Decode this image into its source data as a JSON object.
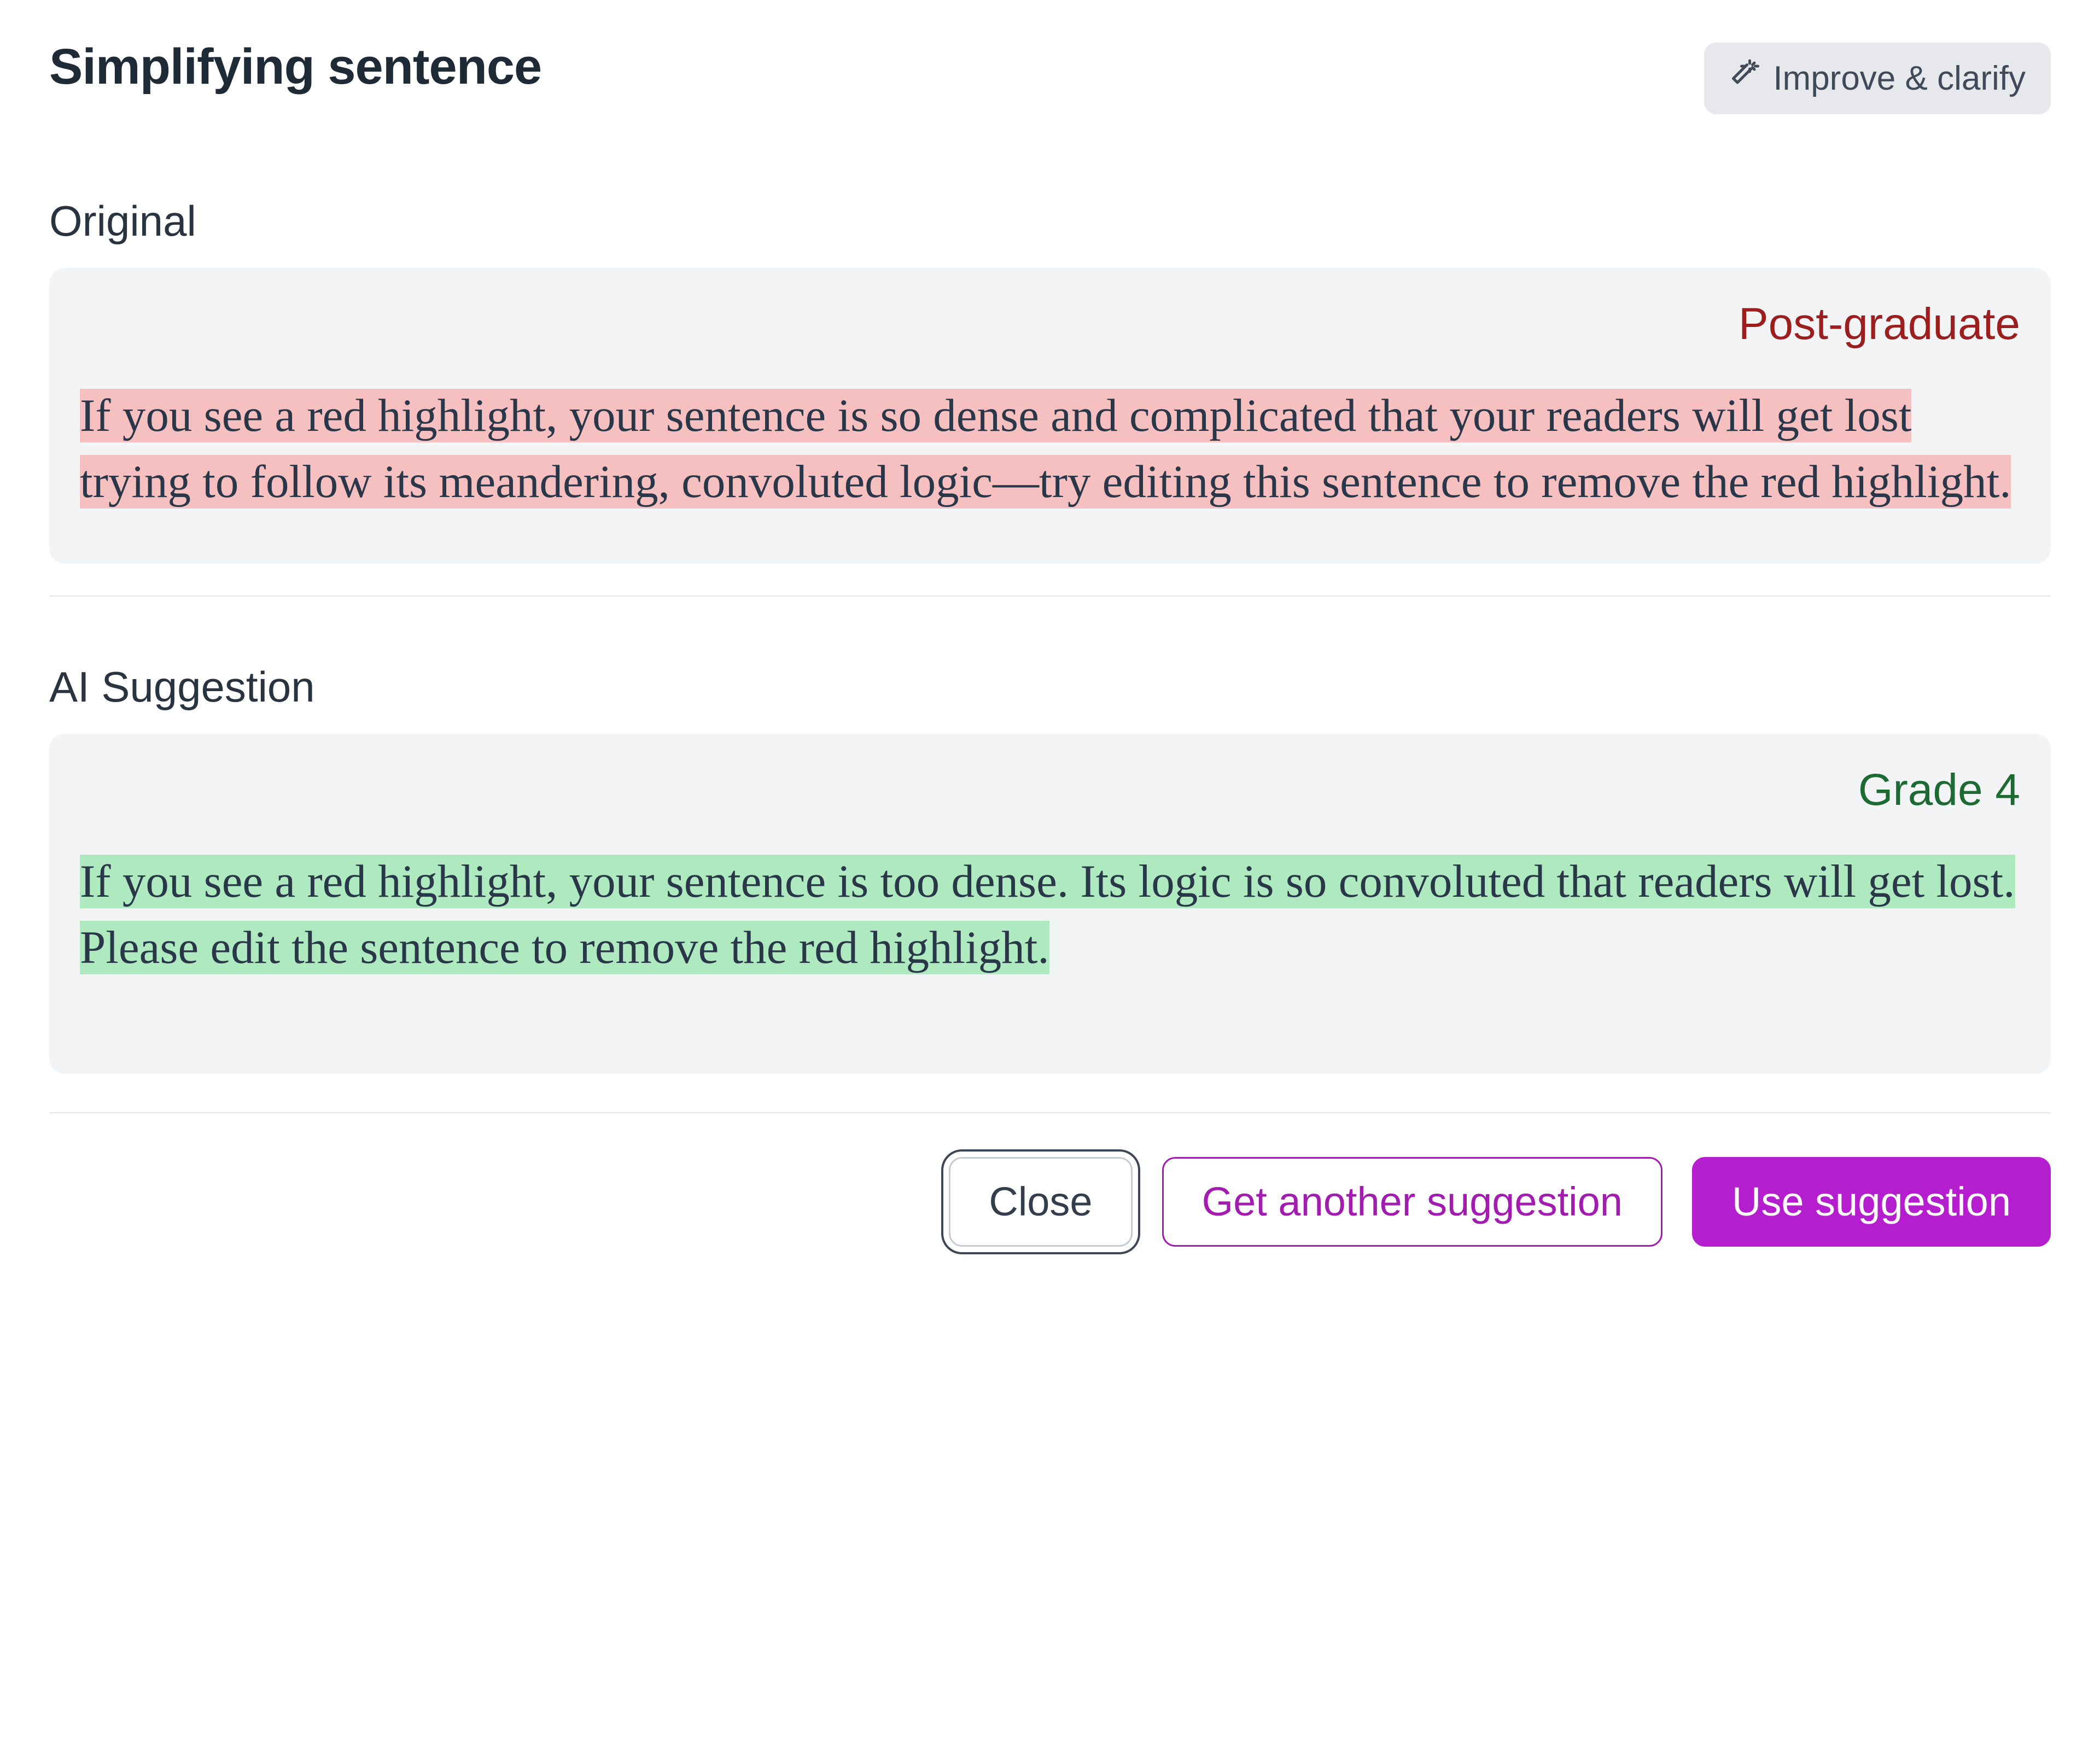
{
  "header": {
    "title": "Simplifying sentence",
    "badge_label": "Improve & clarify",
    "badge_icon": "magic-wand-icon"
  },
  "original": {
    "label": "Original",
    "level": "Post-graduate",
    "text": "If you see a red highlight, your sentence is so dense and complicated that your readers will get lost trying to follow its meandering, convoluted logic—try editing this sentence to remove the red highlight."
  },
  "suggestion": {
    "label": "AI Suggestion",
    "level": "Grade 4",
    "text": "If you see a red highlight, your sentence is too dense. Its logic is so convoluted that readers will get lost. Please edit the sentence to remove the red highlight."
  },
  "actions": {
    "close": "Close",
    "another": "Get another suggestion",
    "use": "Use suggestion"
  },
  "colors": {
    "highlight_red": "#f6c0c0",
    "highlight_green": "#aee9c0",
    "level_bad": "#9c1f1f",
    "level_good": "#1d6b33",
    "primary": "#b51ecf"
  }
}
